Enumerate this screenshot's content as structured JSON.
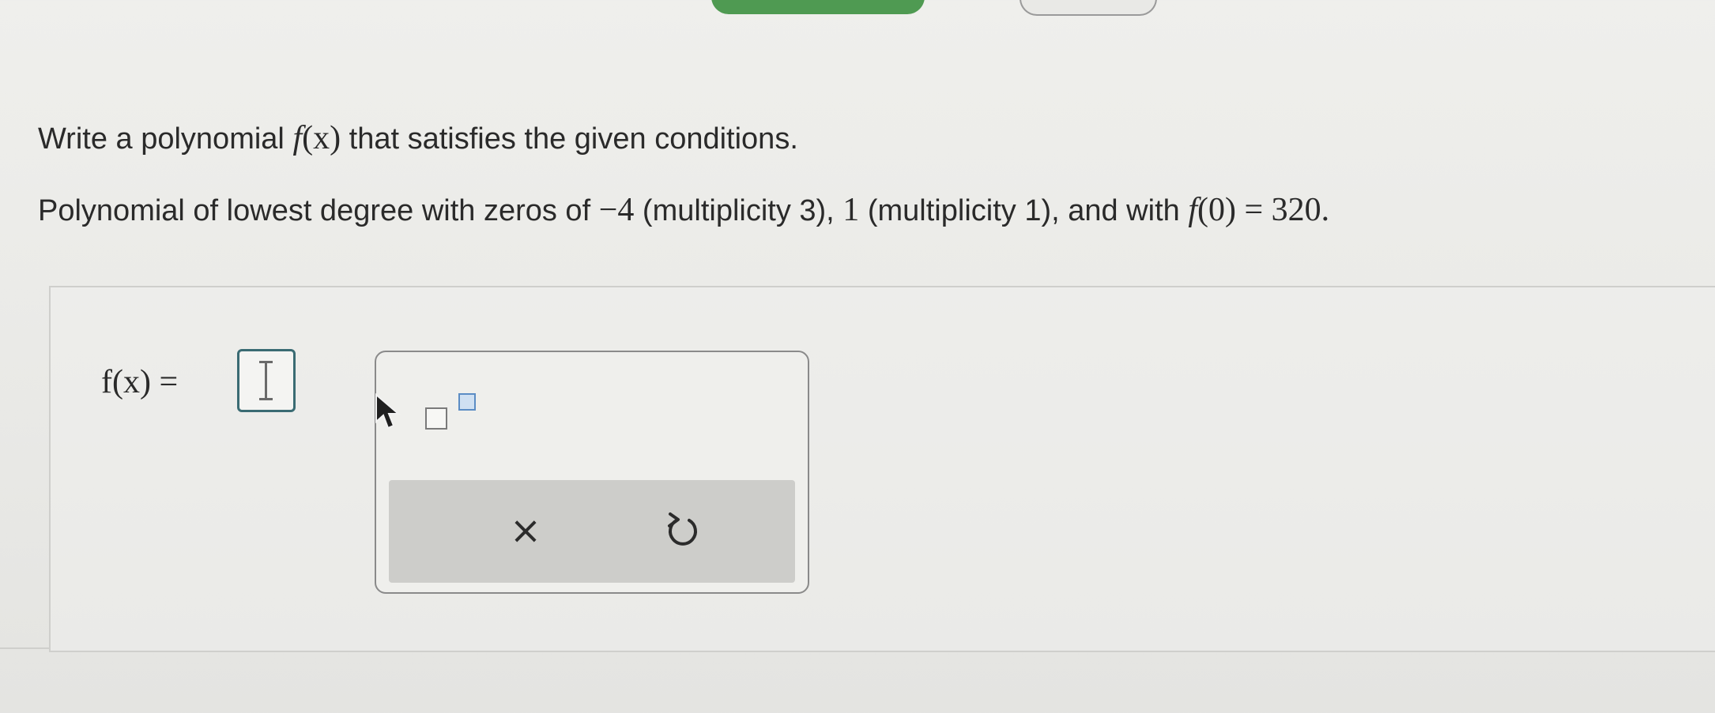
{
  "question": {
    "prompt_before": "Write a polynomial ",
    "prompt_function": "f",
    "prompt_paren": "(x)",
    "prompt_after": " that satisfies the given conditions.",
    "conditions_text_1": "Polynomial of lowest degree with zeros of ",
    "zero1": "−4",
    "zero1_mult": " (multiplicity 3), ",
    "zero2": "1",
    "zero2_mult": " (multiplicity 1), and with ",
    "condition_func": "f",
    "condition_value": "(0) = 320."
  },
  "answer": {
    "label": "f(x) = ",
    "value": ""
  },
  "palette": {
    "clear_symbol": "×",
    "exponent_template_icon": "exponent-template-icon",
    "undo_icon": "undo-icon"
  },
  "colors": {
    "input_border": "#3a6b73",
    "exponent_highlight": "#5b8cc4",
    "action_bar": "#cdcdca",
    "tab_green": "#4f9a52"
  }
}
